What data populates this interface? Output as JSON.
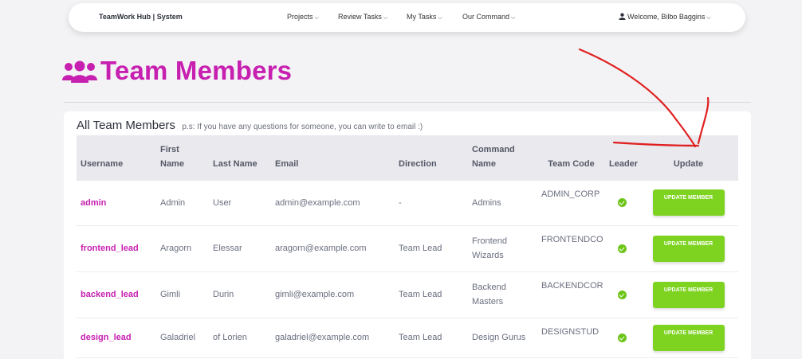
{
  "navbar": {
    "brand": "TeamWork Hub | System",
    "items": [
      {
        "label": "Projects"
      },
      {
        "label": "Review Tasks"
      },
      {
        "label": "My Tasks"
      },
      {
        "label": "Our Command"
      }
    ],
    "user": "Welcome, Bilbo Baggins"
  },
  "page": {
    "title": "Team Members",
    "icon": "users-icon"
  },
  "card": {
    "title": "All Team Members",
    "note": "p.s: If you have any questions for someone, you can write to email :)"
  },
  "table": {
    "headers": {
      "username": "Username",
      "first_name_1": "First",
      "first_name_2": "Name",
      "last_name": "Last Name",
      "email": "Email",
      "direction": "Direction",
      "command_1": "Command",
      "command_2": "Name",
      "team_code": "Team Code",
      "leader": "Leader",
      "update": "Update"
    },
    "rows": [
      {
        "username": "admin",
        "first": "Admin",
        "last": "User",
        "email": "admin@example.com",
        "direction": "-",
        "command_1": "Admins",
        "command_2": "",
        "team_code": "ADMIN_CORP",
        "leader": true,
        "button": "UPDATE MEMBER"
      },
      {
        "username": "frontend_lead",
        "first": "Aragorn",
        "last": "Elessar",
        "email": "aragorn@example.com",
        "direction": "Team Lead",
        "command_1": "Frontend",
        "command_2": "Wizards",
        "team_code": "FRONTENDCO",
        "leader": true,
        "button": "UPDATE MEMBER"
      },
      {
        "username": "backend_lead",
        "first": "Gimli",
        "last": "Durin",
        "email": "gimli@example.com",
        "direction": "Team Lead",
        "command_1": "Backend",
        "command_2": "Masters",
        "team_code": "BACKENDCOR",
        "leader": true,
        "button": "UPDATE MEMBER"
      },
      {
        "username": "design_lead",
        "first": "Galadriel",
        "last": "of Lorien",
        "email": "galadriel@example.com",
        "direction": "Team Lead",
        "command_1": "Design Gurus",
        "command_2": "",
        "team_code": "DESIGNSTUD",
        "leader": true,
        "button": "UPDATE MEMBER"
      }
    ]
  },
  "colors": {
    "accent": "#c71fb0",
    "button": "#7ed321",
    "check": "#6cc417",
    "annotation": "#e02020"
  }
}
